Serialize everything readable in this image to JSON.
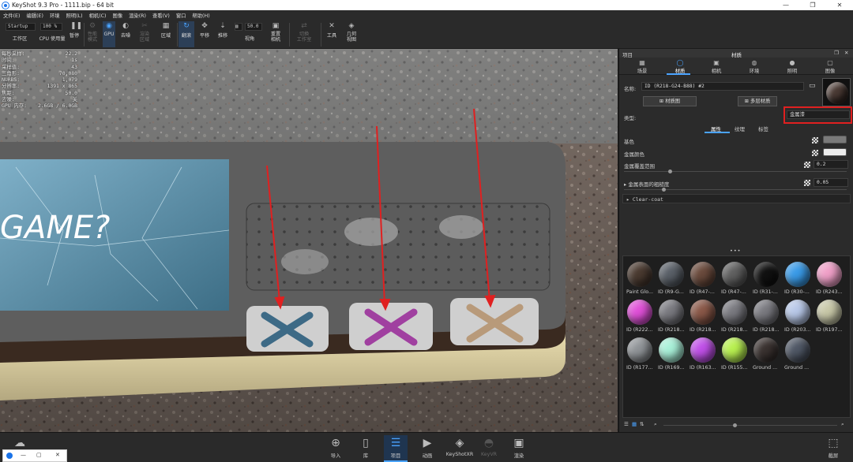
{
  "window": {
    "title": "KeyShot 9.3 Pro  -  1111.bip  -  64 bit",
    "controls": [
      "—",
      "❐",
      "✕"
    ]
  },
  "menu": [
    "文件(E)",
    "编辑(E)",
    "环境",
    "照明(L)",
    "相机(C)",
    "图像",
    "渲染(R)",
    "查看(V)",
    "窗口",
    "帮助(H)"
  ],
  "toolbar": {
    "workspace_value": "Startup",
    "zoom_value": "100 %",
    "fov_value": "50.0",
    "items": {
      "workspace": "工作区",
      "cpu": "CPU 使用量",
      "pause": "暂停",
      "perf": "性能\n模式",
      "gpu": "GPU",
      "denoise": "去噪",
      "region": "渲染\n区域",
      "zone": "区域",
      "tumble": "翻滚",
      "pan": "平移",
      "dolly": "推移",
      "view": "视角",
      "reset_camera": "重置\n相机",
      "switch_ws": "切换\n工作室",
      "tools": "工具",
      "geometry": "几何\n视图"
    }
  },
  "stats": [
    [
      "每秒采样:",
      "22.2"
    ],
    [
      "时间:",
      "1s"
    ],
    [
      "采样值:",
      "43"
    ],
    [
      "三角形:",
      "70,080"
    ],
    [
      "NURBS:",
      "1,079"
    ],
    [
      "分辨率:",
      "1391 x 865"
    ],
    [
      "焦距:",
      "50.0"
    ],
    [
      "去噪:",
      "关"
    ],
    [
      "GPU 内存:",
      "2.6GB / 6.0GB"
    ]
  ],
  "panel": {
    "section_left": "项目",
    "section_title": "材质",
    "tabs": [
      "场景",
      "材质",
      "相机",
      "环境",
      "照明",
      "图像"
    ],
    "name_label": "名称:",
    "name_value": "ID (R218-G24-B88) #2",
    "material_graph_btn": "材质图",
    "multi_material_btn": "多层材质",
    "type_label": "类型:",
    "type_value": "金属漆",
    "subtabs": [
      "属性",
      "纹理",
      "标签"
    ],
    "props": {
      "base_color": "基色",
      "metal_color": "金属颜色",
      "metal_coverage": "金属覆盖范围",
      "metal_coverage_value": "0.2",
      "metal_roughness": "金属表面的粗糙度",
      "metal_roughness_value": "0.05",
      "clear_coat": "Clear-coat"
    },
    "library": [
      {
        "name": "Paint Glo...",
        "color": "#4a3a30"
      },
      {
        "name": "ID (R9-G...",
        "color": "#5a6068"
      },
      {
        "name": "ID (R47-...",
        "color": "#6a4a3c"
      },
      {
        "name": "ID (R47-...",
        "color": "#606060"
      },
      {
        "name": "ID (R31-...",
        "color": "#111111"
      },
      {
        "name": "ID (R30-...",
        "color": "#3a9be8"
      },
      {
        "name": "ID (R243...",
        "color": "#f0a0c8"
      },
      {
        "name": "ID (R222...",
        "color": "#e050d8"
      },
      {
        "name": "ID (R218...",
        "color": "#7a7a80"
      },
      {
        "name": "ID (R218...",
        "color": "#8a5848"
      },
      {
        "name": "ID (R218...",
        "color": "#7a7a80"
      },
      {
        "name": "ID (R218...",
        "color": "#7a7a80"
      },
      {
        "name": "ID (R203...",
        "color": "#b8c8e8"
      },
      {
        "name": "ID (R197...",
        "color": "#c8c8a8"
      },
      {
        "name": "ID (R177...",
        "color": "#909498"
      },
      {
        "name": "ID (R169...",
        "color": "#a8f0d8"
      },
      {
        "name": "ID (R163...",
        "color": "#c050e8"
      },
      {
        "name": "ID (R155...",
        "color": "#b8f050"
      },
      {
        "name": "Ground ...",
        "color": "#3a3230"
      },
      {
        "name": "Ground ...",
        "color": "#505866"
      }
    ]
  },
  "viewport": {
    "logo_text": "GAME?"
  },
  "bottom": {
    "import": "导入",
    "library": "库",
    "project": "项目",
    "animation": "动画",
    "keyshotxr": "KeyShotXR",
    "keyvr": "KeyVR",
    "render": "渲染",
    "cloud": "",
    "fullscreen": "截屏"
  }
}
